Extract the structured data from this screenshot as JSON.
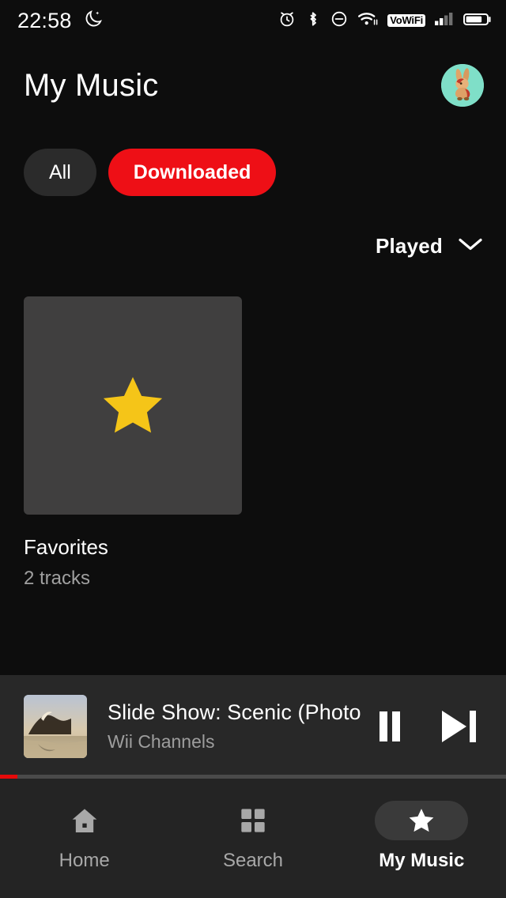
{
  "status_bar": {
    "time": "22:58",
    "left_icons": [
      "dnd-moon-icon"
    ],
    "right_icons": [
      "alarm-icon",
      "bluetooth-icon",
      "do-not-disturb-icon",
      "wifi-icon",
      "signal-icon",
      "battery-icon"
    ],
    "vowifi_label": "VoWiFi",
    "battery_level": 70,
    "signal_bars": 2
  },
  "header": {
    "title": "My Music",
    "avatar_icon": "rabbit-avatar",
    "avatar_bg": "#7fdfc8"
  },
  "filters": {
    "chips": [
      {
        "label": "All",
        "selected": false
      },
      {
        "label": "Downloaded",
        "selected": true
      }
    ],
    "selected_color": "#ee0f16"
  },
  "sort": {
    "label": "Played",
    "icon": "chevron-down-icon"
  },
  "library": {
    "items": [
      {
        "title": "Favorites",
        "subtitle": "2 tracks",
        "art_icon": "star-icon",
        "art_bg": "#403f3f",
        "star_color": "#f5c518"
      }
    ]
  },
  "mini_player": {
    "track_title": "Slide Show: Scenic (Photo",
    "artist": "Wii Channels",
    "artwork_icon": "album-art-thumbnail",
    "pause_label": "Pause",
    "next_label": "Next track",
    "progress_percent": 3.5,
    "progress_color": "#e60a0a"
  },
  "bottom_nav": {
    "items": [
      {
        "label": "Home",
        "icon": "home-icon",
        "active": false
      },
      {
        "label": "Search",
        "icon": "grid-search-icon",
        "active": false
      },
      {
        "label": "My Music",
        "icon": "star-icon",
        "active": true
      }
    ]
  }
}
